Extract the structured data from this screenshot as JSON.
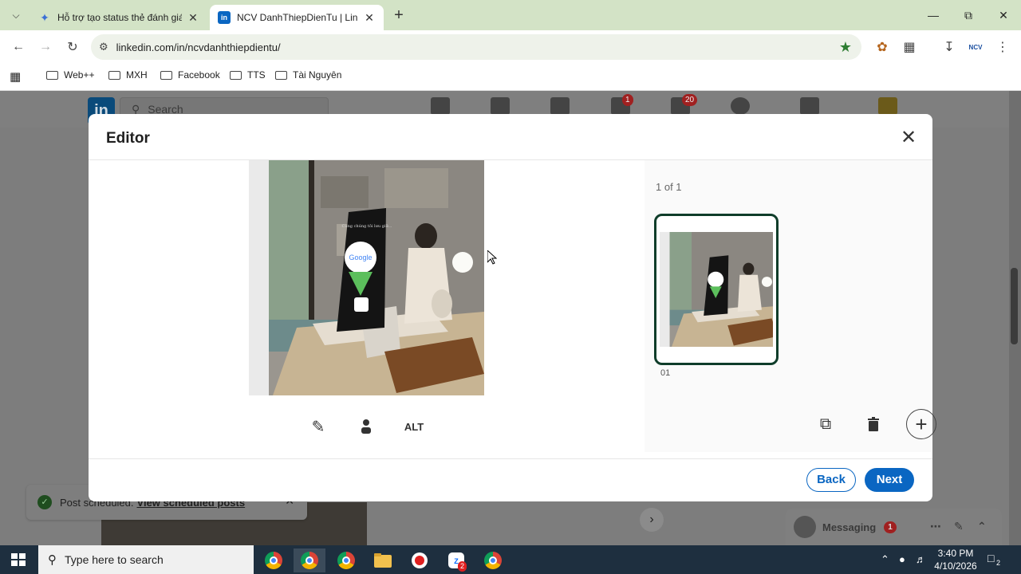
{
  "browser": {
    "tabs": [
      {
        "title": "Hỗ trợ tạo status thẻ đánh giá Google",
        "favicon": "gemini-icon"
      },
      {
        "title": "NCV DanhThiepDienTu | LinkedIn",
        "favicon": "linkedin-icon",
        "active": true
      }
    ],
    "url": "linkedin.com/in/ncvdanhthiepdientu/",
    "bookmarks": [
      "Web++",
      "MXH",
      "Facebook",
      "TTS",
      "Tài Nguyên"
    ],
    "profile_label": "NCV"
  },
  "linkedin": {
    "logo": "in",
    "search_placeholder": "Search",
    "messaging_badge": "1",
    "notifications_badge": "20",
    "toast_text": "Post scheduled.",
    "toast_link": "View scheduled posts",
    "messaging_label": "Messaging",
    "messaging_count": "1"
  },
  "editor": {
    "title": "Editor",
    "count_label": "1 of 1",
    "thumb_number": "01",
    "tools": {
      "alt": "ALT"
    },
    "back_label": "Back",
    "next_label": "Next",
    "photo_card_text": "Cùng chúng tôi lưu giữ...",
    "photo_card_brand": "Google"
  },
  "taskbar": {
    "search_placeholder": "Type here to search",
    "time": "3:40 PM",
    "date": "4/10/2026",
    "zalo_badge": "2",
    "notification_count": "2"
  },
  "colors": {
    "linkedin_blue": "#0a66c2",
    "tabstrip_green": "#d3e3c6",
    "thumb_border": "#0f3d2a"
  }
}
